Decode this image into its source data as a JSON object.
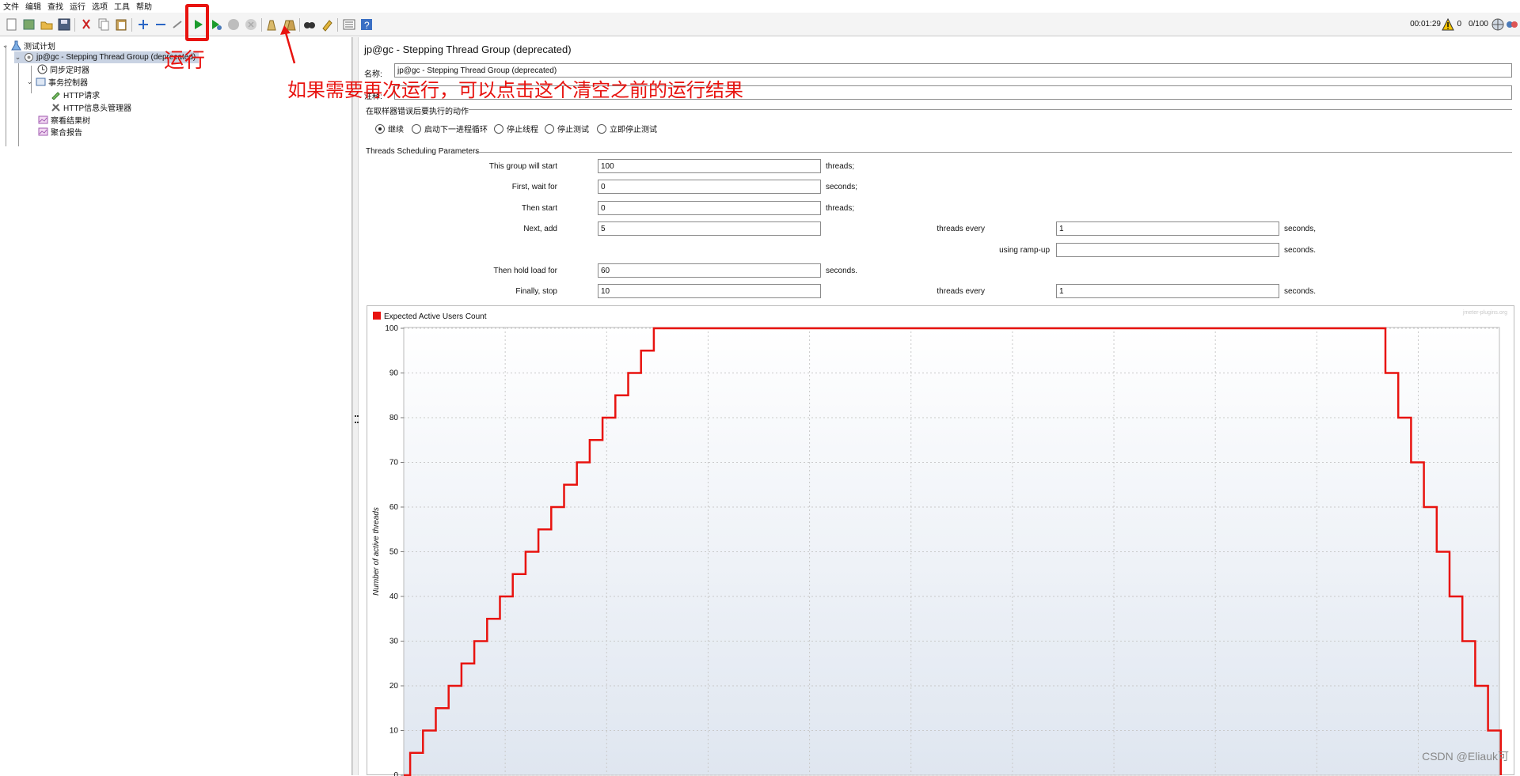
{
  "menu": [
    "文件",
    "编辑",
    "查找",
    "运行",
    "选项",
    "工具",
    "帮助"
  ],
  "status": {
    "elapsed": "00:01:29",
    "errors": "0",
    "threads": "0/100"
  },
  "tree": {
    "root": "测试计划",
    "thread_group": "jp@gc - Stepping Thread Group (deprecated)",
    "timer": "同步定时器",
    "controller": "事务控制器",
    "http_request": "HTTP请求",
    "header_manager": "HTTP信息头管理器",
    "result_tree": "察看结果树",
    "aggregate": "聚合报告"
  },
  "panel": {
    "title": "jp@gc - Stepping Thread Group (deprecated)",
    "name_label": "名称:",
    "name_value": "jp@gc - Stepping Thread Group (deprecated)",
    "comment_label": "注释:",
    "comment_value": "",
    "error_section": "在取样器错误后要执行的动作",
    "error_options": [
      "继续",
      "启动下一进程循环",
      "停止线程",
      "停止测试",
      "立即停止测试"
    ],
    "error_selected": "继续",
    "sched_section": "Threads Scheduling Parameters",
    "group_start_label": "This group will start",
    "group_start": "100",
    "threads_unit": "threads;",
    "first_wait_label": "First, wait for",
    "first_wait": "0",
    "seconds_unit": "seconds;",
    "then_start_label": "Then start",
    "then_start": "0",
    "next_add_label": "Next, add",
    "next_add": "5",
    "threads_every": "threads every",
    "next_every": "1",
    "seconds_comma": "seconds,",
    "ramp_label": "using ramp-up",
    "ramp_value": "",
    "seconds_dot": "seconds.",
    "hold_label": "Then hold load for",
    "hold_value": "60",
    "finally_label": "Finally, stop",
    "finally_value": "10",
    "finally_every": "1"
  },
  "chart_data": {
    "type": "line",
    "legend": "Expected Active Users Count",
    "ylabel": "Number of active threads",
    "watermark": "jmeter-plugins.org",
    "ylim": [
      0,
      100
    ],
    "yticks": [
      0,
      10,
      20,
      30,
      40,
      50,
      60,
      70,
      80,
      90,
      100
    ],
    "color": "#e8130f",
    "series": [
      {
        "values": [
          0,
          5,
          5,
          10,
          10,
          15,
          15,
          20,
          20,
          25,
          25,
          30,
          30,
          35,
          35,
          40,
          40,
          45,
          45,
          50,
          50,
          55,
          55,
          60,
          60,
          65,
          65,
          70,
          70,
          75,
          75,
          80,
          80,
          85,
          85,
          90,
          90,
          95,
          95,
          100,
          100,
          90,
          90,
          80,
          80,
          70,
          70,
          60,
          60,
          50,
          50,
          40,
          40,
          30,
          30,
          20,
          20,
          10,
          10,
          0
        ]
      }
    ]
  },
  "annotations": {
    "run": "运行",
    "note": "如果需要再次运行，可以点击这个清空之前的运行结果",
    "watermark": "CSDN @Eliauk可"
  }
}
